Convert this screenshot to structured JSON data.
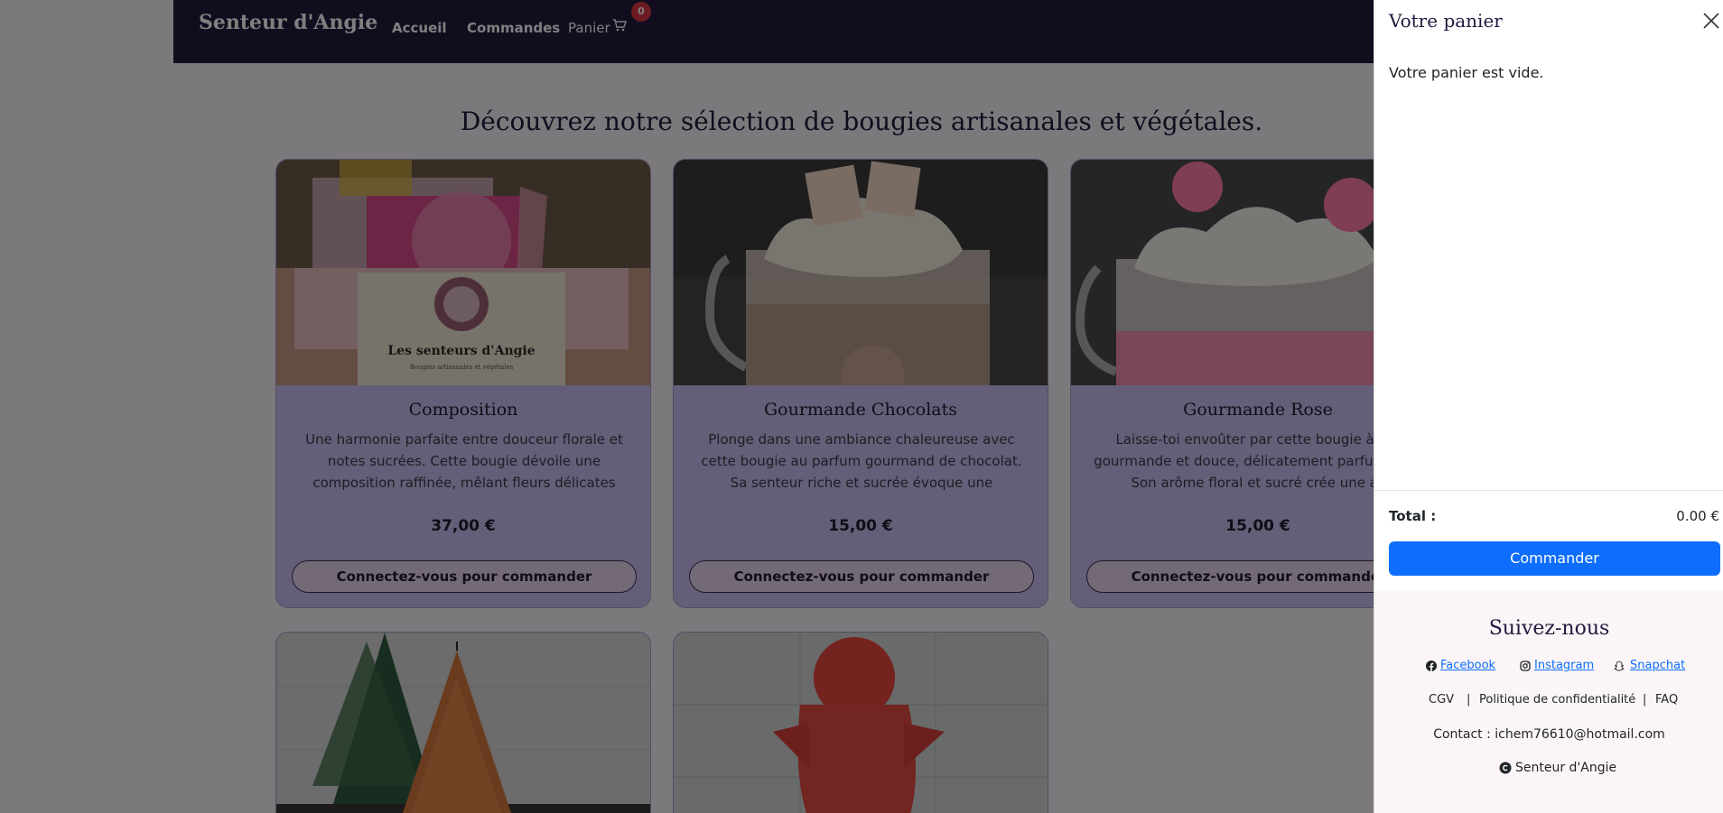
{
  "navbar": {
    "brand": "Senteur d'Angie",
    "links": [
      "Accueil",
      "Commandes",
      "Panier"
    ],
    "cart_count": "0"
  },
  "headline": "Découvrez notre sélection de bougies artisanales et végétales.",
  "products": [
    {
      "name": "Composition",
      "description": "Une harmonie parfaite entre douceur florale et notes sucrées. Cette bougie dévoile une composition raffinée, mêlant fleurs délicates et…",
      "price": "37,00 €",
      "button": "Connectez-vous pour commander",
      "card_text": [
        "Les senteurs d'Angie",
        "Bougies artisanales et végétales",
        "Les senteurs d'Angie"
      ]
    },
    {
      "name": "Gourmande Chocolats",
      "description": "Plonge dans une ambiance chaleureuse avec cette bougie au parfum gourmand de chocolat. Sa senteur riche et sucrée évoque une tablette…",
      "price": "15,00 €",
      "button": "Connectez-vous pour commander"
    },
    {
      "name": "Gourmande Rose",
      "description": "Laisse-toi envoûter par cette bougie à la s gourmande et douce, délicatement parfum rose. Son arôme floral et sucré crée une an",
      "price": "15,00 €",
      "button": "Connectez-vous pour commander"
    }
  ],
  "panier": {
    "title": "Votre panier",
    "empty_message": "Votre panier est vide.",
    "total_label": "Total :",
    "total_value": "0.00 €",
    "order_button": "Commander"
  },
  "footer": {
    "title": "Suivez-nous",
    "social": [
      "Facebook",
      "Instagram",
      "Snapchat"
    ],
    "links": [
      "CGV",
      "|",
      "Politique de confidentialité",
      "|",
      "FAQ"
    ],
    "contact": "Contact : ichem76610@hotmail.com",
    "copyright": "Senteur d'Angie"
  },
  "colors": {
    "navbar": "#221a3f",
    "card": "#c9bdf1",
    "primary": "#0d6efd",
    "badge": "#dc3545"
  }
}
